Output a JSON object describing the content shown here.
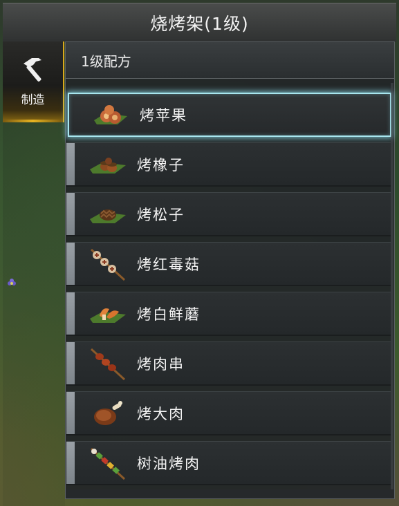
{
  "window": {
    "title": "烧烤架(1级)"
  },
  "sidebar": {
    "tabs": [
      {
        "label": "制造",
        "icon": "hammer-icon",
        "active": true
      }
    ]
  },
  "recipes": {
    "header": "1级配方",
    "items": [
      {
        "label": "烤苹果",
        "icon": "roasted-apple-icon",
        "selected": true
      },
      {
        "label": "烤橡子",
        "icon": "roasted-acorn-icon",
        "selected": false
      },
      {
        "label": "烤松子",
        "icon": "roasted-pinecone-icon",
        "selected": false
      },
      {
        "label": "烤红毒菇",
        "icon": "mushroom-skewer-icon",
        "selected": false
      },
      {
        "label": "烤白鲜蘑",
        "icon": "roasted-white-mushroom-icon",
        "selected": false
      },
      {
        "label": "烤肉串",
        "icon": "meat-skewer-icon",
        "selected": false
      },
      {
        "label": "烤大肉",
        "icon": "roasted-big-meat-icon",
        "selected": false
      },
      {
        "label": "树油烤肉",
        "icon": "resin-roast-skewer-icon",
        "selected": false
      }
    ]
  },
  "colors": {
    "accent_gold": "#d9a81c",
    "selection_glow": "#a8e6ef",
    "row_marker": "#9aa0a6"
  }
}
